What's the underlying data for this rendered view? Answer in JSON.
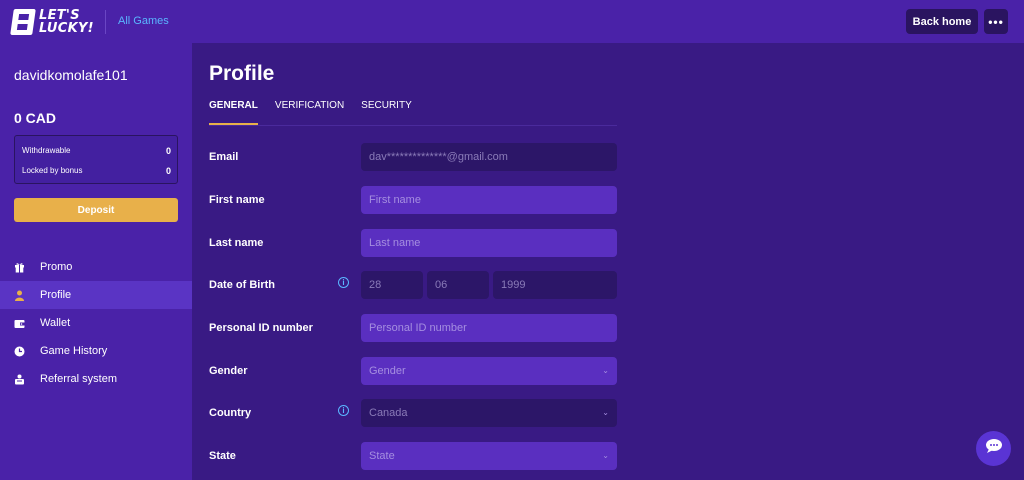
{
  "header": {
    "logo_text_line1": "LET'S",
    "logo_text_line2": "LUCKY!",
    "all_games": "All Games",
    "back_home": "Back home",
    "more": "•••"
  },
  "sidebar": {
    "username": "davidkomolafe101",
    "balance": "0 CAD",
    "withdrawable_label": "Withdrawable",
    "withdrawable_value": "0",
    "locked_label": "Locked by bonus",
    "locked_value": "0",
    "deposit": "Deposit",
    "items": [
      {
        "label": "Promo",
        "icon": "gift-icon"
      },
      {
        "label": "Profile",
        "icon": "user-icon"
      },
      {
        "label": "Wallet",
        "icon": "wallet-icon"
      },
      {
        "label": "Game History",
        "icon": "clock-icon"
      },
      {
        "label": "Referral system",
        "icon": "referral-icon"
      }
    ]
  },
  "main": {
    "title": "Profile",
    "tabs": [
      "GENERAL",
      "VERIFICATION",
      "SECURITY"
    ],
    "fields": {
      "email": {
        "label": "Email",
        "value": "dav**************@gmail.com"
      },
      "first_name": {
        "label": "First name",
        "placeholder": "First name"
      },
      "last_name": {
        "label": "Last name",
        "placeholder": "Last name"
      },
      "dob": {
        "label": "Date of Birth",
        "day": "28",
        "month": "06",
        "year": "1999"
      },
      "personal_id": {
        "label": "Personal ID number",
        "placeholder": "Personal ID number"
      },
      "gender": {
        "label": "Gender",
        "value": "Gender"
      },
      "country": {
        "label": "Country",
        "value": "Canada"
      },
      "state": {
        "label": "State",
        "value": "State"
      }
    }
  },
  "colors": {
    "accent": "#e8b04a",
    "link": "#5ab6ff",
    "sidebar_bg": "#4a22a8",
    "main_bg": "#391a84"
  }
}
